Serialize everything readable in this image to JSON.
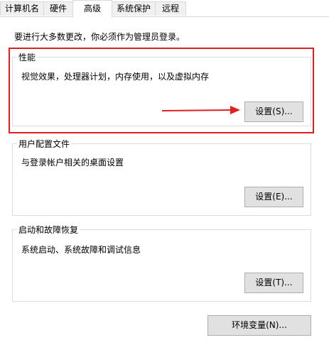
{
  "tabs": [
    "计算机名",
    "硬件",
    "高级",
    "系统保护",
    "远程"
  ],
  "active_tab": "高级",
  "notice": "要进行大多数更改，你必须作为管理员登录。",
  "groups": {
    "performance": {
      "title": "性能",
      "desc": "视觉效果，处理器计划，内存使用，以及虚拟内存",
      "button": "设置(S)..."
    },
    "user_profile": {
      "title": "用户配置文件",
      "desc": "与登录帐户相关的桌面设置",
      "button": "设置(E)..."
    },
    "startup": {
      "title": "启动和故障恢复",
      "desc": "系统启动、系统故障和调试信息",
      "button": "设置(T)..."
    }
  },
  "env_button": "环境变量(N)...",
  "annotation_color": "#e02020"
}
